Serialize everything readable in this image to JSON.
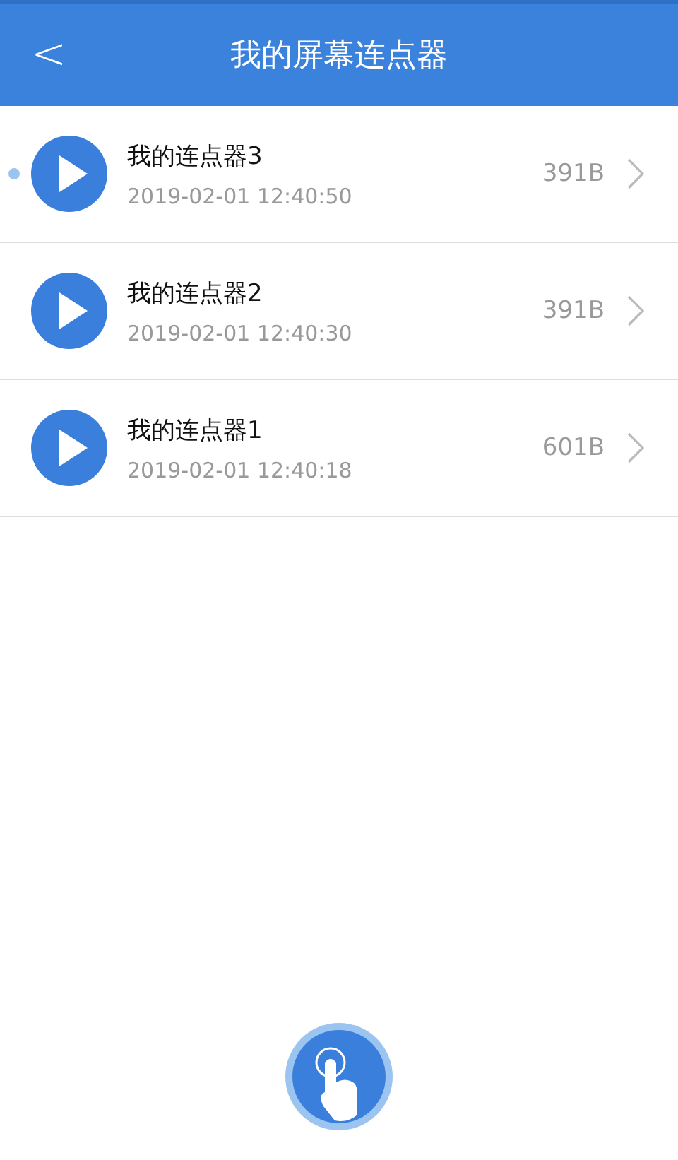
{
  "header": {
    "back": "<",
    "title": "我的屏幕连点器"
  },
  "items": [
    {
      "name": "我的连点器3",
      "time": "2019-02-01 12:40:50",
      "size": "391B",
      "marked": true
    },
    {
      "name": "我的连点器2",
      "time": "2019-02-01 12:40:30",
      "size": "391B",
      "marked": false
    },
    {
      "name": "我的连点器1",
      "time": "2019-02-01 12:40:18",
      "size": "601B",
      "marked": false
    }
  ]
}
